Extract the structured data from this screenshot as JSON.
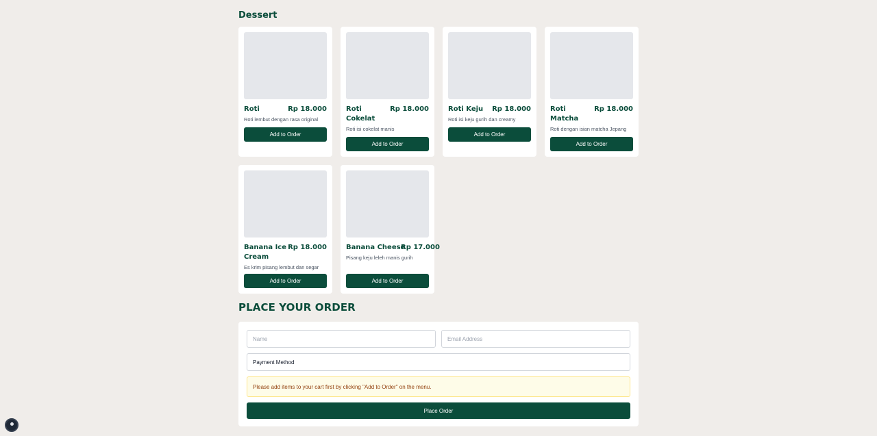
{
  "menu": {
    "category": "Dessert",
    "items": [
      {
        "name": "Roti",
        "price": "Rp 18.000",
        "desc": "Roti lembut dengan rasa original",
        "button": "Add to Order"
      },
      {
        "name": "Roti Cokelat",
        "price": "Rp 18.000",
        "desc": "Roti isi cokelat manis",
        "button": "Add to Order"
      },
      {
        "name": "Roti Keju",
        "price": "Rp 18.000",
        "desc": "Roti isi keju gurih dan creamy",
        "button": "Add to Order"
      },
      {
        "name": "Roti Matcha",
        "price": "Rp 18.000",
        "desc": "Roti dengan isian matcha Jepang",
        "button": "Add to Order"
      },
      {
        "name": "Banana Ice Cream",
        "price": "Rp 18.000",
        "desc": "Es krim pisang lembut dan segar",
        "button": "Add to Order"
      },
      {
        "name": "Banana Cheese",
        "price": "Rp 17.000",
        "desc": "Pisang keju leleh manis gurih",
        "button": "Add to Order"
      }
    ]
  },
  "order": {
    "title": "PLACE YOUR ORDER",
    "name_placeholder": "Name",
    "email_placeholder": "Email Address",
    "payment_method": "Payment Method",
    "notice": "Please add items to your cart first by clicking \"Add to Order\" on the menu.",
    "submit": "Place Order"
  },
  "colors": {
    "brand": "#0b4d3b",
    "background": "#f0edea",
    "notice_bg": "#fefce8"
  }
}
